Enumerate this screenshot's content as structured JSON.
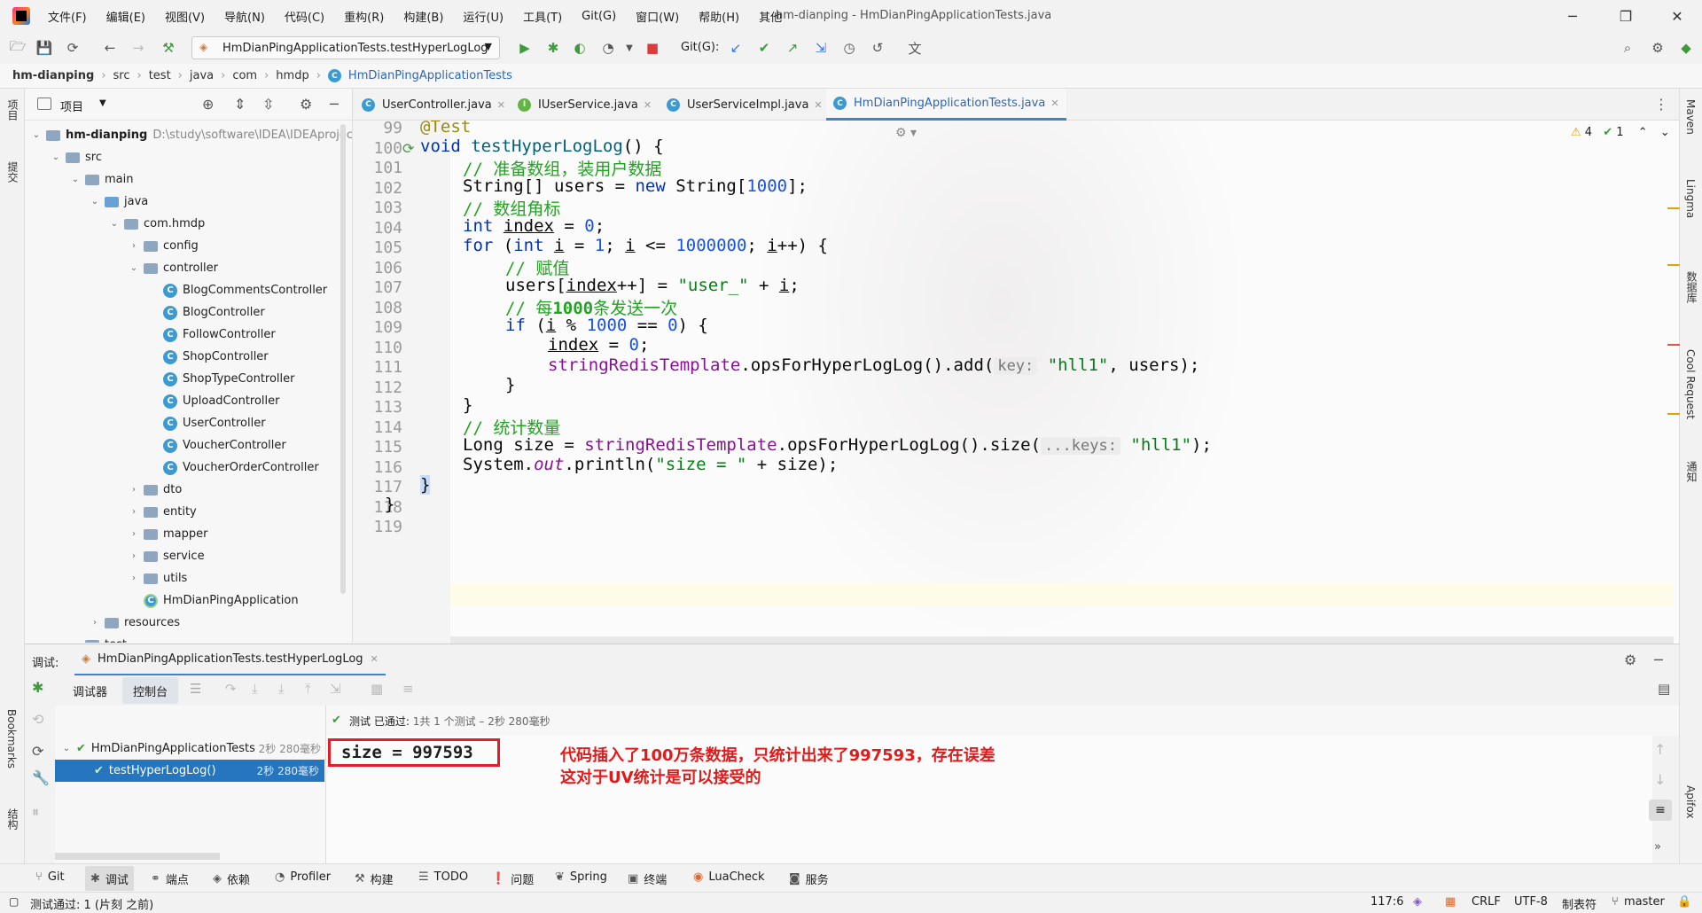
{
  "menu": {
    "items": [
      "文件(F)",
      "编辑(E)",
      "视图(V)",
      "导航(N)",
      "代码(C)",
      "重构(R)",
      "构建(B)",
      "运行(U)",
      "工具(T)",
      "Git(G)",
      "窗口(W)",
      "帮助(H)",
      "其他"
    ],
    "window_title": "hm-dianping - HmDianPingApplicationTests.java"
  },
  "toolbar": {
    "run_config": "HmDianPingApplicationTests.testHyperLogLog",
    "git_label": "Git(G):"
  },
  "breadcrumb": [
    "hm-dianping",
    "src",
    "test",
    "java",
    "com",
    "hmdp",
    "HmDianPingApplicationTests"
  ],
  "project_panel": {
    "title": "项目",
    "root": "hm-dianping",
    "root_path": "D:\\study\\software\\IDEA\\IDEAproject",
    "tree": [
      {
        "label": "src",
        "type": "folder",
        "level": 1,
        "open": true
      },
      {
        "label": "main",
        "type": "folder",
        "level": 2,
        "open": true
      },
      {
        "label": "java",
        "type": "srcfolder",
        "level": 3,
        "open": true
      },
      {
        "label": "com.hmdp",
        "type": "folder",
        "level": 4,
        "open": true
      },
      {
        "label": "config",
        "type": "folder",
        "level": 5,
        "open": false
      },
      {
        "label": "controller",
        "type": "folder",
        "level": 5,
        "open": true
      },
      {
        "label": "BlogCommentsController",
        "type": "class",
        "level": 6
      },
      {
        "label": "BlogController",
        "type": "class",
        "level": 6
      },
      {
        "label": "FollowController",
        "type": "class",
        "level": 6
      },
      {
        "label": "ShopController",
        "type": "class",
        "level": 6
      },
      {
        "label": "ShopTypeController",
        "type": "class",
        "level": 6
      },
      {
        "label": "UploadController",
        "type": "class",
        "level": 6
      },
      {
        "label": "UserController",
        "type": "class",
        "level": 6
      },
      {
        "label": "VoucherController",
        "type": "class",
        "level": 6
      },
      {
        "label": "VoucherOrderController",
        "type": "class",
        "level": 6
      },
      {
        "label": "dto",
        "type": "folder",
        "level": 5,
        "open": false
      },
      {
        "label": "entity",
        "type": "folder",
        "level": 5,
        "open": false
      },
      {
        "label": "mapper",
        "type": "folder",
        "level": 5,
        "open": false
      },
      {
        "label": "service",
        "type": "folder",
        "level": 5,
        "open": false
      },
      {
        "label": "utils",
        "type": "folder",
        "level": 5,
        "open": false
      },
      {
        "label": "HmDianPingApplication",
        "type": "appclass",
        "level": 5
      },
      {
        "label": "resources",
        "type": "folder",
        "level": 3,
        "open": false
      },
      {
        "label": "test",
        "type": "folder",
        "level": 2,
        "open": true
      }
    ]
  },
  "tabs": [
    {
      "label": "UserController.java",
      "icon": "c"
    },
    {
      "label": "IUserService.java",
      "icon": "i"
    },
    {
      "label": "UserServiceImpl.java",
      "icon": "c"
    },
    {
      "label": "HmDianPingApplicationTests.java",
      "icon": "c",
      "active": true
    }
  ],
  "editor": {
    "warnings": "4",
    "checks": "1",
    "line_numbers": [
      "99",
      "100",
      "101",
      "102",
      "103",
      "104",
      "105",
      "106",
      "107",
      "108",
      "109",
      "110",
      "111",
      "112",
      "113",
      "114",
      "115",
      "116",
      "117",
      "118",
      "119"
    ],
    "code": {
      "l99": "@Test",
      "l100_kw": "void ",
      "l100_fn": "testHyperLogLog",
      "l100_rest": "() {",
      "l101": "// 准备数组，装用户数据",
      "l102_a": "String[] users = ",
      "l102_kw": "new ",
      "l102_b": "String[",
      "l102_num": "1000",
      "l102_c": "];",
      "l103": "// 数组角标",
      "l104_kw": "int ",
      "l104_var": "index",
      "l104_a": " = ",
      "l104_num": "0",
      "l104_b": ";",
      "l105_kw": "for ",
      "l105_a": "(",
      "l105_kw2": "int ",
      "l105_i": "i",
      "l105_b": " = ",
      "l105_n1": "1",
      "l105_c": "; ",
      "l105_i2": "i",
      "l105_d": " <= ",
      "l105_n2": "1000000",
      "l105_e": "; ",
      "l105_i3": "i",
      "l105_f": "++) {",
      "l106": "// 赋值",
      "l107_a": "users[",
      "l107_idx": "index",
      "l107_b": "++] = ",
      "l107_str": "\"user_\"",
      "l107_c": " + ",
      "l107_i": "i",
      "l107_d": ";",
      "l108_a": "// 每",
      "l108_b": "1000",
      "l108_c": "条发送一次",
      "l109_kw": "if ",
      "l109_a": "(",
      "l109_i": "i",
      "l109_b": " % ",
      "l109_n1": "1000",
      "l109_c": " == ",
      "l109_n2": "0",
      "l109_d": ") {",
      "l110_idx": "index",
      "l110_a": " = ",
      "l110_n": "0",
      "l110_b": ";",
      "l111_fld": "stringRedisTemplate",
      "l111_a": ".opsForHyperLogLog().add(",
      "l111_hint": "key:",
      "l111_str": "\"hll1\"",
      "l111_b": ", users);",
      "l112": "}",
      "l113": "}",
      "l114": "// 统计数量",
      "l115_a": "Long size = ",
      "l115_fld": "stringRedisTemplate",
      "l115_b": ".opsForHyperLogLog().size(",
      "l115_hint": "...keys:",
      "l115_str": "\"hll1\"",
      "l115_c": ");",
      "l116_a": "System.",
      "l116_out": "out",
      "l116_b": ".println(",
      "l116_str": "\"size = \"",
      "l116_c": " + size);",
      "l117": "}",
      "l118": "}"
    }
  },
  "debug": {
    "label": "调试:",
    "session": "HmDianPingApplicationTests.testHyperLogLog",
    "tab_debugger": "调试器",
    "tab_console": "控制台",
    "test_status_a": "测试 已通过: ",
    "test_status_b": "1共 1 个测试 – 2秒 280毫秒",
    "tree": [
      {
        "label": "HmDianPingApplicationTests",
        "duration": "2秒 280毫秒"
      },
      {
        "label": "testHyperLogLog()",
        "duration": "2秒 280毫秒",
        "selected": true
      }
    ],
    "output": "size = 997593",
    "note_line1": "代码插入了100万条数据，只统计出来了997593，存在误差",
    "note_line2": "这对于UV统计是可以接受的"
  },
  "bottom_tools": [
    "Git",
    "调试",
    "端点",
    "依赖",
    "Profiler",
    "构建",
    "TODO",
    "问题",
    "Spring",
    "终端",
    "LuaCheck",
    "服务"
  ],
  "status": {
    "message": "测试通过: 1 (片刻 之前)",
    "position": "117:6",
    "line_sep": "CRLF",
    "encoding": "UTF-8",
    "indent": "制表符",
    "branch": "master"
  },
  "left_strip": {
    "project": "项目",
    "commit": "提交",
    "bookmarks": "Bookmarks",
    "structure": "结构"
  },
  "right_strip": [
    "Maven",
    "Lingma",
    "数据库",
    "Cool Request",
    "通知",
    "Apifox"
  ]
}
